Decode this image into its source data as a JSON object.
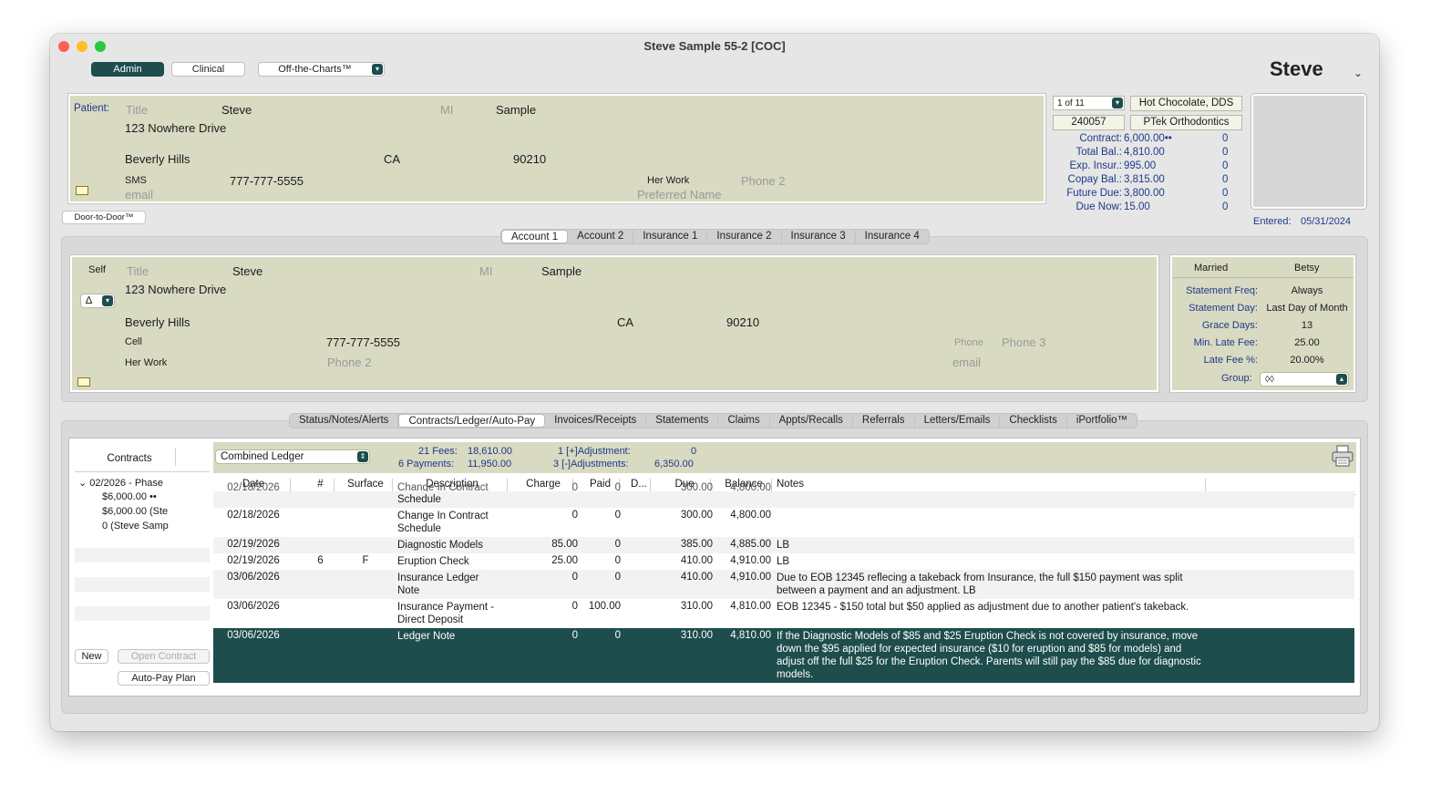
{
  "window": {
    "title": "Steve Sample 55-2 [COC]",
    "user_name": "Steve",
    "modes": [
      "Admin",
      "Clinical"
    ],
    "plugin_menu": "Off-the-Charts™",
    "colors": {
      "accent": "#1d4d4c",
      "panel": "#d9dac2",
      "label_blue": "#1e3a8a"
    }
  },
  "patient": {
    "label": "Patient:",
    "title_placeholder": "Title",
    "first": "Steve",
    "mi_placeholder": "MI",
    "last": "Sample",
    "address": "123 Nowhere Drive",
    "city": "Beverly Hills",
    "state": "CA",
    "zip": "90210",
    "phone1_label": "SMS",
    "phone1": "777-777-5555",
    "phone2_label": "Her Work",
    "phone2_placeholder": "Phone 2",
    "email_placeholder": "email",
    "preferred_placeholder": "Preferred Name",
    "door_button": "Door-to-Door™"
  },
  "account_summary": {
    "record_nav": "1 of 11",
    "doctor": "Hot Chocolate, DDS",
    "account_no": "240057",
    "practice": "PTek Orthodontics",
    "rows": [
      {
        "label": "Contract:",
        "value": "6,000.00••",
        "extra": "0"
      },
      {
        "label": "Total Bal.:",
        "value": "4,810.00",
        "extra": "0"
      },
      {
        "label": "Exp. Insur.:",
        "value": "995.00",
        "extra": "0"
      },
      {
        "label": "Copay Bal.:",
        "value": "3,815.00",
        "extra": "0"
      },
      {
        "label": "Future Due:",
        "value": "3,800.00",
        "extra": "0"
      },
      {
        "label": "Due Now:",
        "value": "15.00",
        "extra": "0"
      }
    ],
    "entered_label": "Entered:",
    "entered_date": "05/31/2024"
  },
  "account_tabs": [
    "Account 1",
    "Account 2",
    "Insurance 1",
    "Insurance 2",
    "Insurance 3",
    "Insurance 4"
  ],
  "responsible": {
    "relation": "Self",
    "delta_select": "∆",
    "title_placeholder": "Title",
    "first": "Steve",
    "mi_placeholder": "MI",
    "last": "Sample",
    "address": "123 Nowhere Drive",
    "city": "Beverly Hills",
    "state": "CA",
    "zip": "90210",
    "phone1_label": "Cell",
    "phone1": "777-777-5555",
    "phone2_label": "Her Work",
    "phone2_placeholder": "Phone 2",
    "phone3_label": "Phone",
    "phone3_placeholder": "Phone 3",
    "email_placeholder": "email"
  },
  "billing": {
    "marital": "Married",
    "spouse": "Betsy",
    "rows": [
      {
        "label": "Statement Freq:",
        "value": "Always"
      },
      {
        "label": "Statement Day:",
        "value": "Last Day of Month"
      },
      {
        "label": "Grace Days:",
        "value": "13"
      },
      {
        "label": "Min. Late Fee:",
        "value": "25.00"
      },
      {
        "label": "Late Fee %:",
        "value": "20.00%"
      }
    ],
    "group_label": "Group:",
    "group_value": "◊◊"
  },
  "main_tabs": [
    "Status/Notes/Alerts",
    "Contracts/Ledger/Auto-Pay",
    "Invoices/Receipts",
    "Statements",
    "Claims",
    "Appts/Recalls",
    "Referrals",
    "Letters/Emails",
    "Checklists",
    "iPortfolio™"
  ],
  "contracts": {
    "header": "Contracts",
    "tree_root": "02/2026 - Phase",
    "items": [
      "$6,000.00 ••",
      "$6,000.00 (Ste",
      "0 (Steve Samp"
    ],
    "new_button": "New",
    "open_button": "Open Contract",
    "autopay_button": "Auto-Pay Plan"
  },
  "ledger": {
    "view_select": "Combined Ledger",
    "fees_label": "21 Fees:",
    "fees_value": "18,610.00",
    "payments_label": "6 Payments:",
    "payments_value": "11,950.00",
    "plus_adj_label": "1 [+]Adjustment:",
    "plus_adj_value": "0",
    "minus_adj_label": "3 [-]Adjustments:",
    "minus_adj_value": "6,350.00",
    "columns": [
      "Date",
      "#",
      "Surface",
      "Description",
      "Charge",
      "Paid",
      "D...",
      "Due",
      "Balance",
      "Notes"
    ],
    "partial_row": {
      "date": "02/18/2026",
      "desc": "Change In Contract",
      "charge": "0",
      "paid": "0",
      "due": "300.00",
      "balance": "4,800.00"
    },
    "rows": [
      {
        "date": "",
        "num": "",
        "surface": "",
        "desc": "Schedule",
        "charge": "",
        "paid": "",
        "due": "",
        "balance": "",
        "notes": ""
      },
      {
        "date": "02/18/2026",
        "num": "",
        "surface": "",
        "desc": "Change In Contract Schedule",
        "charge": "0",
        "paid": "0",
        "due": "300.00",
        "balance": "4,800.00",
        "notes": ""
      },
      {
        "date": "02/19/2026",
        "num": "",
        "surface": "",
        "desc": "Diagnostic Models",
        "charge": "85.00",
        "paid": "0",
        "due": "385.00",
        "balance": "4,885.00",
        "notes": "LB"
      },
      {
        "date": "02/19/2026",
        "num": "6",
        "surface": "F",
        "desc": "Eruption Check",
        "charge": "25.00",
        "paid": "0",
        "due": "410.00",
        "balance": "4,910.00",
        "notes": "LB"
      },
      {
        "date": "03/06/2026",
        "num": "",
        "surface": "",
        "desc": "Insurance Ledger Note",
        "charge": "0",
        "paid": "0",
        "due": "410.00",
        "balance": "4,910.00",
        "notes": "Due to EOB 12345 reflecing a takeback from Insurance, the full $150 payment was split between a payment and an adjustment. LB"
      },
      {
        "date": "03/06/2026",
        "num": "",
        "surface": "",
        "desc": "Insurance Payment - Direct Deposit",
        "charge": "0",
        "paid": "100.00",
        "due": "310.00",
        "balance": "4,810.00",
        "notes": "EOB 12345 - $150 total but $50 applied as adjustment due to another patient's takeback."
      },
      {
        "date": "03/06/2026",
        "num": "",
        "surface": "",
        "desc": "Ledger Note",
        "charge": "0",
        "paid": "0",
        "due": "310.00",
        "balance": "4,810.00",
        "notes": "If the Diagnostic Models of $85 and $25 Eruption Check is not covered by insurance, move down the $95 applied for expected insurance ($10 for eruption and $85 for models) and adjust off the full $25 for the Eruption Check. Parents will still pay the $85 due for diagnostic models."
      }
    ]
  }
}
